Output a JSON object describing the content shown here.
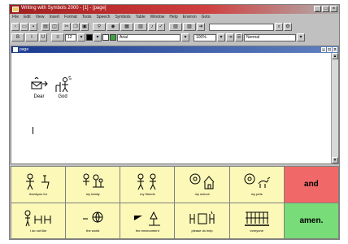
{
  "window": {
    "title": "Writing with Symbols 2000 - [1] - [page]",
    "buttons": [
      "_",
      "□",
      "×"
    ]
  },
  "menu": [
    "File",
    "Edit",
    "View",
    "Insert",
    "Format",
    "Tools",
    "Speech",
    "Symbols",
    "Table",
    "Window",
    "Help",
    "Environ",
    "Goto"
  ],
  "toolbar2": {
    "font_size": "12",
    "font_name": "Arial",
    "zoom": "100%",
    "style": "Normal"
  },
  "document": {
    "title": "page",
    "words": [
      "Dear",
      "God"
    ]
  },
  "grid": {
    "row1": [
      {
        "label": "thankyou   for"
      },
      {
        "label": "my  family"
      },
      {
        "label": "my  friends"
      },
      {
        "label": "my  school"
      },
      {
        "label": "my  pets"
      },
      {
        "label": "and"
      }
    ],
    "row2": [
      {
        "label": "I  do  not  like"
      },
      {
        "label": "the  world"
      },
      {
        "label": "the  environment"
      },
      {
        "label": "please  do  help"
      },
      {
        "label": "everyone"
      },
      {
        "label": "amen."
      }
    ]
  },
  "colors": {
    "cell_yellow": "#fbf8b8",
    "cell_red": "#f06868",
    "cell_green": "#78dc78",
    "titlebar": "#c03030"
  }
}
